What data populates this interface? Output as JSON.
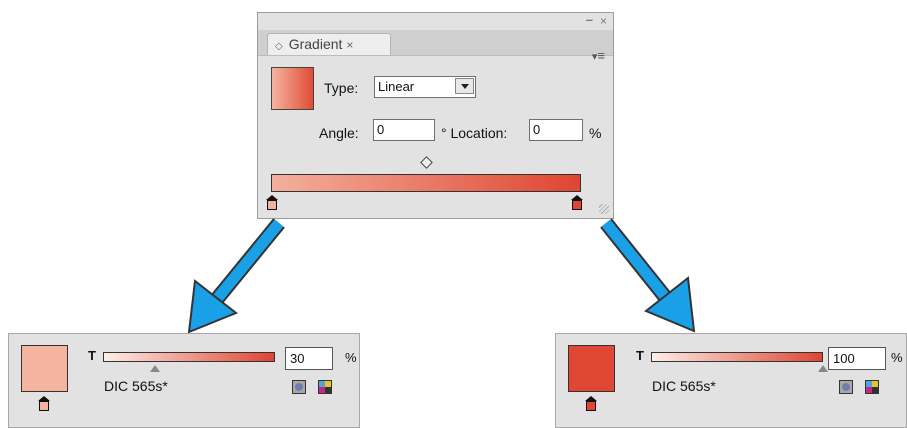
{
  "gradient_panel": {
    "window_min": "–",
    "window_close": "×",
    "tab_label": "Gradient",
    "tab_close": "×",
    "type_label": "Type:",
    "type_value": "Linear",
    "angle_label": "Angle:",
    "angle_value": "0",
    "location_label": "° Location:",
    "location_value": "0",
    "location_unit": "%",
    "start_color": "#f3b09c",
    "end_color": "#df4532"
  },
  "arrow_color": "#1aa0e6",
  "left_swatch": {
    "tint_label": "T",
    "tint_value": "30",
    "tint_unit": "%",
    "tint_fraction": 0.3,
    "swatch_name": "DIC 565s*",
    "color": "#f5b4a0"
  },
  "right_swatch": {
    "tint_label": "T",
    "tint_value": "100",
    "tint_unit": "%",
    "tint_fraction": 1.0,
    "swatch_name": "DIC 565s*",
    "color": "#df4634"
  },
  "icons": [
    "panel-menu-icon",
    "diamond-icon",
    "spot-color-icon",
    "cmyk-icon",
    "gradient-stop-icon",
    "resize-grip-icon"
  ]
}
